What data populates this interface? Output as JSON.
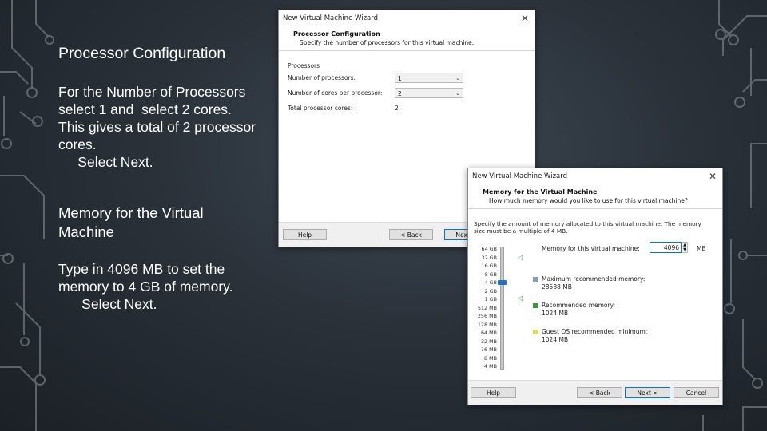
{
  "slide": {
    "section1_title": "Processor Configuration",
    "section1_lines": [
      "For the Number of Processors",
      "select 1 and  select 2 cores.",
      "This gives a total of 2 processor",
      "cores.",
      "     Select Next."
    ],
    "section2_title_lines": [
      "Memory for the Virtual",
      "Machine"
    ],
    "section2_lines": [
      "Type in 4096 MB to set the",
      "memory to 4 GB of memory.",
      "      Select Next."
    ]
  },
  "processor_dialog": {
    "window_title": "New Virtual Machine Wizard",
    "close_glyph": "✕",
    "header_title": "Processor Configuration",
    "header_subtitle": "Specify the number of processors for this virtual machine.",
    "group_label": "Processors",
    "num_processors_label": "Number of processors:",
    "num_processors_value": "1",
    "cores_label": "Number of cores per processor:",
    "cores_value": "2",
    "total_label": "Total processor cores:",
    "total_value": "2",
    "help_button": "Help",
    "back_button": "< Back",
    "next_button": "Next >"
  },
  "memory_dialog": {
    "window_title": "New Virtual Machine Wizard",
    "close_glyph": "✕",
    "header_title": "Memory for the Virtual Machine",
    "header_subtitle": "How much memory would you like to use for this virtual machine?",
    "description": "Specify the amount of memory allocated to this virtual machine. The memory size must be a multiple of 4 MB.",
    "memory_label": "Memory for this virtual machine:",
    "memory_value": "4096",
    "memory_unit": "MB",
    "scale_ticks": [
      "64 GB",
      "32 GB",
      "16 GB",
      "8 GB",
      "4 GB",
      "2 GB",
      "1 GB",
      "512 MB",
      "256 MB",
      "128 MB",
      "64 MB",
      "32 MB",
      "16 MB",
      "8 MB",
      "4 MB"
    ],
    "slider_value": "4 GB",
    "max_recommended_label": "Maximum recommended memory:",
    "max_recommended_value": "28588 MB",
    "recommended_label": "Recommended memory:",
    "recommended_value": "1024 MB",
    "guest_min_label": "Guest OS recommended minimum:",
    "guest_min_value": "1024 MB",
    "help_button": "Help",
    "back_button": "< Back",
    "next_button": "Next >",
    "cancel_button": "Cancel",
    "colors": {
      "max_marker": "#7f9db9",
      "recommended_marker": "#2e9c3a",
      "guest_min_marker": "#e8d84a",
      "slider_thumb": "#1c73c9"
    }
  }
}
